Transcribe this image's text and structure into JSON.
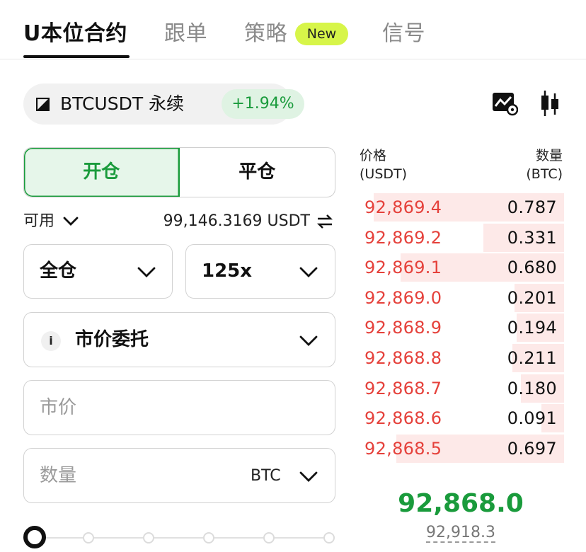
{
  "tabs": [
    {
      "label": "U本位合约",
      "active": true
    },
    {
      "label": "跟单",
      "active": false
    },
    {
      "label": "策略",
      "active": false
    },
    {
      "label": "信号",
      "active": false
    }
  ],
  "new_badge": "New",
  "symbol": {
    "name": "BTCUSDT 永续",
    "change": "+1.94%",
    "change_color": "#1a9b3c"
  },
  "icons": {
    "chart": "chart-settings-icon",
    "candle": "candlestick-icon"
  },
  "position_tabs": {
    "open": "开仓",
    "close": "平仓",
    "active": "open"
  },
  "available": {
    "label": "可用",
    "value": "99,146.3169 USDT"
  },
  "margin_mode": "全仓",
  "leverage": "125x",
  "order_type": {
    "info": "i",
    "label": "市价委托"
  },
  "price_input": {
    "placeholder": "市价"
  },
  "quantity_input": {
    "placeholder": "数量",
    "unit": "BTC"
  },
  "slider": {
    "level": 0,
    "marks": [
      0,
      25,
      50,
      75,
      100
    ]
  },
  "order_book": {
    "price_header": "价格",
    "price_unit": "(USDT)",
    "qty_header": "数量",
    "qty_unit": "(BTC)",
    "asks": [
      {
        "price": "92,869.4",
        "qty": "0.787",
        "depth": 0.92
      },
      {
        "price": "92,869.2",
        "qty": "0.331",
        "depth": 0.39
      },
      {
        "price": "92,869.1",
        "qty": "0.680",
        "depth": 0.79
      },
      {
        "price": "92,869.0",
        "qty": "0.201",
        "depth": 0.24
      },
      {
        "price": "92,868.9",
        "qty": "0.194",
        "depth": 0.23
      },
      {
        "price": "92,868.8",
        "qty": "0.211",
        "depth": 0.25
      },
      {
        "price": "92,868.7",
        "qty": "0.180",
        "depth": 0.21
      },
      {
        "price": "92,868.6",
        "qty": "0.091",
        "depth": 0.11
      },
      {
        "price": "92,868.5",
        "qty": "0.697",
        "depth": 0.81
      }
    ],
    "ask_color": "#e5413b",
    "last_price": "92,868.0",
    "last_price_color": "#1a9b3c",
    "mark_price": "92,918.3"
  }
}
